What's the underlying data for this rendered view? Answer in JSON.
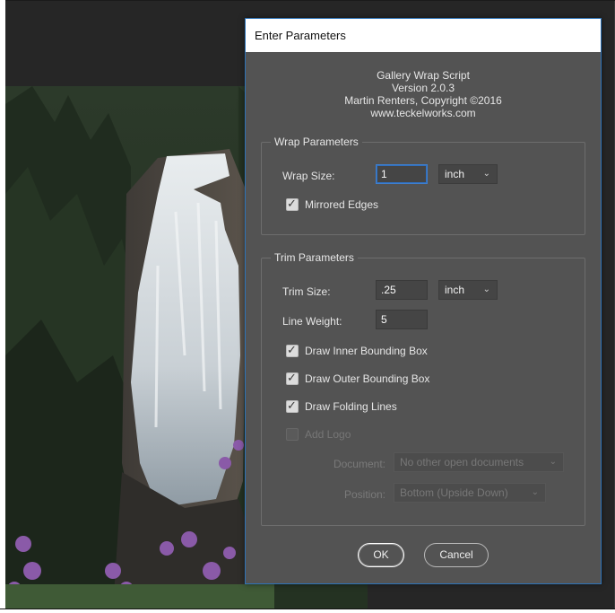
{
  "dialog": {
    "title": "Enter Parameters",
    "about": {
      "line1": "Gallery Wrap Script",
      "line2": "Version 2.0.3",
      "line3": "Martin Renters, Copyright ©2016",
      "line4": "www.teckelworks.com"
    },
    "wrap": {
      "legend": "Wrap Parameters",
      "size_label": "Wrap Size:",
      "size_value": "1",
      "unit": "inch",
      "mirrored_label": "Mirrored Edges",
      "mirrored_checked": true
    },
    "trim": {
      "legend": "Trim Parameters",
      "size_label": "Trim Size:",
      "size_value": ".25",
      "unit": "inch",
      "weight_label": "Line Weight:",
      "weight_value": "5",
      "inner_label": "Draw Inner Bounding Box",
      "outer_label": "Draw Outer Bounding Box",
      "folding_label": "Draw Folding Lines",
      "logo_label": "Add Logo",
      "document_label": "Document:",
      "document_value": "No other open documents",
      "position_label": "Position:",
      "position_value": "Bottom (Upside Down)"
    },
    "buttons": {
      "ok": "OK",
      "cancel": "Cancel"
    }
  },
  "colors": {
    "dialog_bg": "#535353",
    "focus_blue": "#3f7fce",
    "workspace": "#262626"
  }
}
